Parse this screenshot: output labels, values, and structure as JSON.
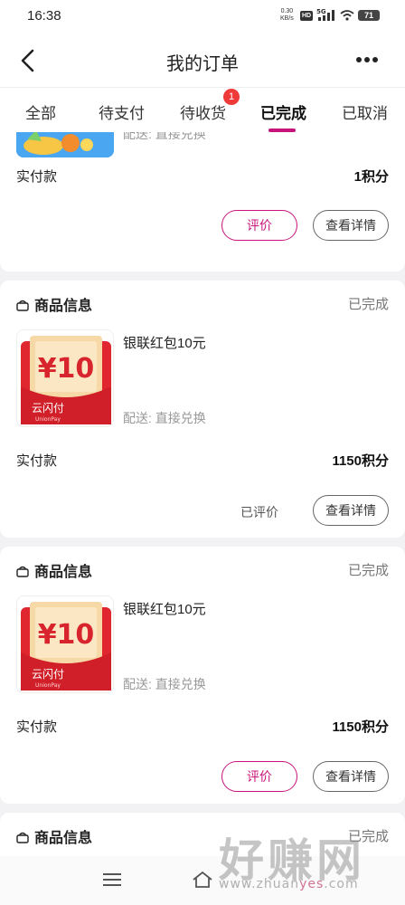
{
  "status_bar": {
    "time": "16:38",
    "net_speed": "0.30",
    "net_unit": "KB/s",
    "hd": "HD",
    "signal": "5G",
    "battery": "71"
  },
  "header": {
    "title": "我的订单"
  },
  "tabs": [
    {
      "label": "全部"
    },
    {
      "label": "待支付"
    },
    {
      "label": "待收货",
      "badge": "1"
    },
    {
      "label": "已完成",
      "active": true
    },
    {
      "label": "已取消"
    }
  ],
  "orders": [
    {
      "delivery": "配送: 直接兑换",
      "paid_label": "实付款",
      "paid_value": "1积分",
      "review_label": "评价",
      "detail_label": "查看详情"
    },
    {
      "section_title": "商品信息",
      "status": "已完成",
      "product_name": "银联红包10元",
      "thumb_amount": "¥10",
      "thumb_brand": "云闪付",
      "thumb_brand_en": "UnionPay",
      "delivery": "配送: 直接兑换",
      "paid_label": "实付款",
      "paid_value": "1150积分",
      "reviewed_label": "已评价",
      "detail_label": "查看详情"
    },
    {
      "section_title": "商品信息",
      "status": "已完成",
      "product_name": "银联红包10元",
      "thumb_amount": "¥10",
      "thumb_brand": "云闪付",
      "thumb_brand_en": "UnionPay",
      "delivery": "配送: 直接兑换",
      "paid_label": "实付款",
      "paid_value": "1150积分",
      "review_label": "评价",
      "detail_label": "查看详情"
    },
    {
      "section_title": "商品信息",
      "status": "已完成"
    }
  ],
  "watermark": {
    "text": "好赚网",
    "url_prefix": "www.zhuan",
    "url_highlight": "yes",
    "url_suffix": ".com"
  },
  "colors": {
    "accent": "#c8137a",
    "badge": "#f03a3a",
    "background": "#f2f2f4"
  }
}
